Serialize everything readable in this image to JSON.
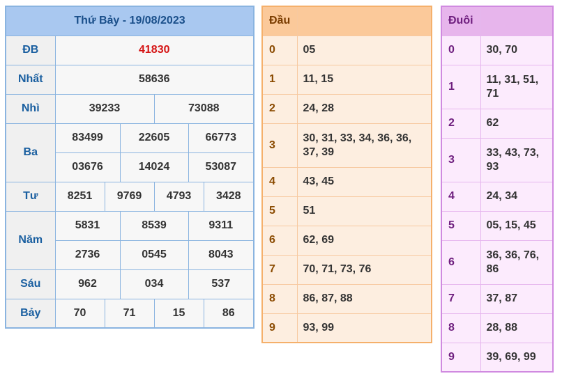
{
  "results": {
    "title": "Thứ Bảy - 19/08/2023",
    "labels": {
      "db": "ĐB",
      "nhat": "Nhất",
      "nhi": "Nhì",
      "ba": "Ba",
      "tu": "Tư",
      "nam": "Năm",
      "sau": "Sáu",
      "bay": "Bảy"
    },
    "db": "41830",
    "nhat": "58636",
    "nhi": [
      "39233",
      "73088"
    ],
    "ba": [
      "83499",
      "22605",
      "66773",
      "03676",
      "14024",
      "53087"
    ],
    "tu": [
      "8251",
      "9769",
      "4793",
      "3428"
    ],
    "nam": [
      "5831",
      "8539",
      "9311",
      "2736",
      "0545",
      "8043"
    ],
    "sau": [
      "962",
      "034",
      "537"
    ],
    "bay": [
      "70",
      "71",
      "15",
      "86"
    ]
  },
  "dau": {
    "header": "Đầu",
    "rows": [
      {
        "key": "0",
        "values": "05"
      },
      {
        "key": "1",
        "values": "11, 15"
      },
      {
        "key": "2",
        "values": "24, 28"
      },
      {
        "key": "3",
        "values": "30, 31, 33, 34, 36, 36, 37, 39"
      },
      {
        "key": "4",
        "values": "43, 45"
      },
      {
        "key": "5",
        "values": "51"
      },
      {
        "key": "6",
        "values": "62, 69"
      },
      {
        "key": "7",
        "values": "70, 71, 73, 76"
      },
      {
        "key": "8",
        "values": "86, 87, 88"
      },
      {
        "key": "9",
        "values": "93, 99"
      }
    ]
  },
  "duoi": {
    "header": "Đuôi",
    "rows": [
      {
        "key": "0",
        "values": "30, 70"
      },
      {
        "key": "1",
        "values": "11, 31, 51, 71"
      },
      {
        "key": "2",
        "values": "62"
      },
      {
        "key": "3",
        "values": "33, 43, 73, 93"
      },
      {
        "key": "4",
        "values": "24, 34"
      },
      {
        "key": "5",
        "values": "05, 15, 45"
      },
      {
        "key": "6",
        "values": "36, 36, 76, 86"
      },
      {
        "key": "7",
        "values": "37, 87"
      },
      {
        "key": "8",
        "values": "28, 88"
      },
      {
        "key": "9",
        "values": "39, 69, 99"
      }
    ]
  }
}
